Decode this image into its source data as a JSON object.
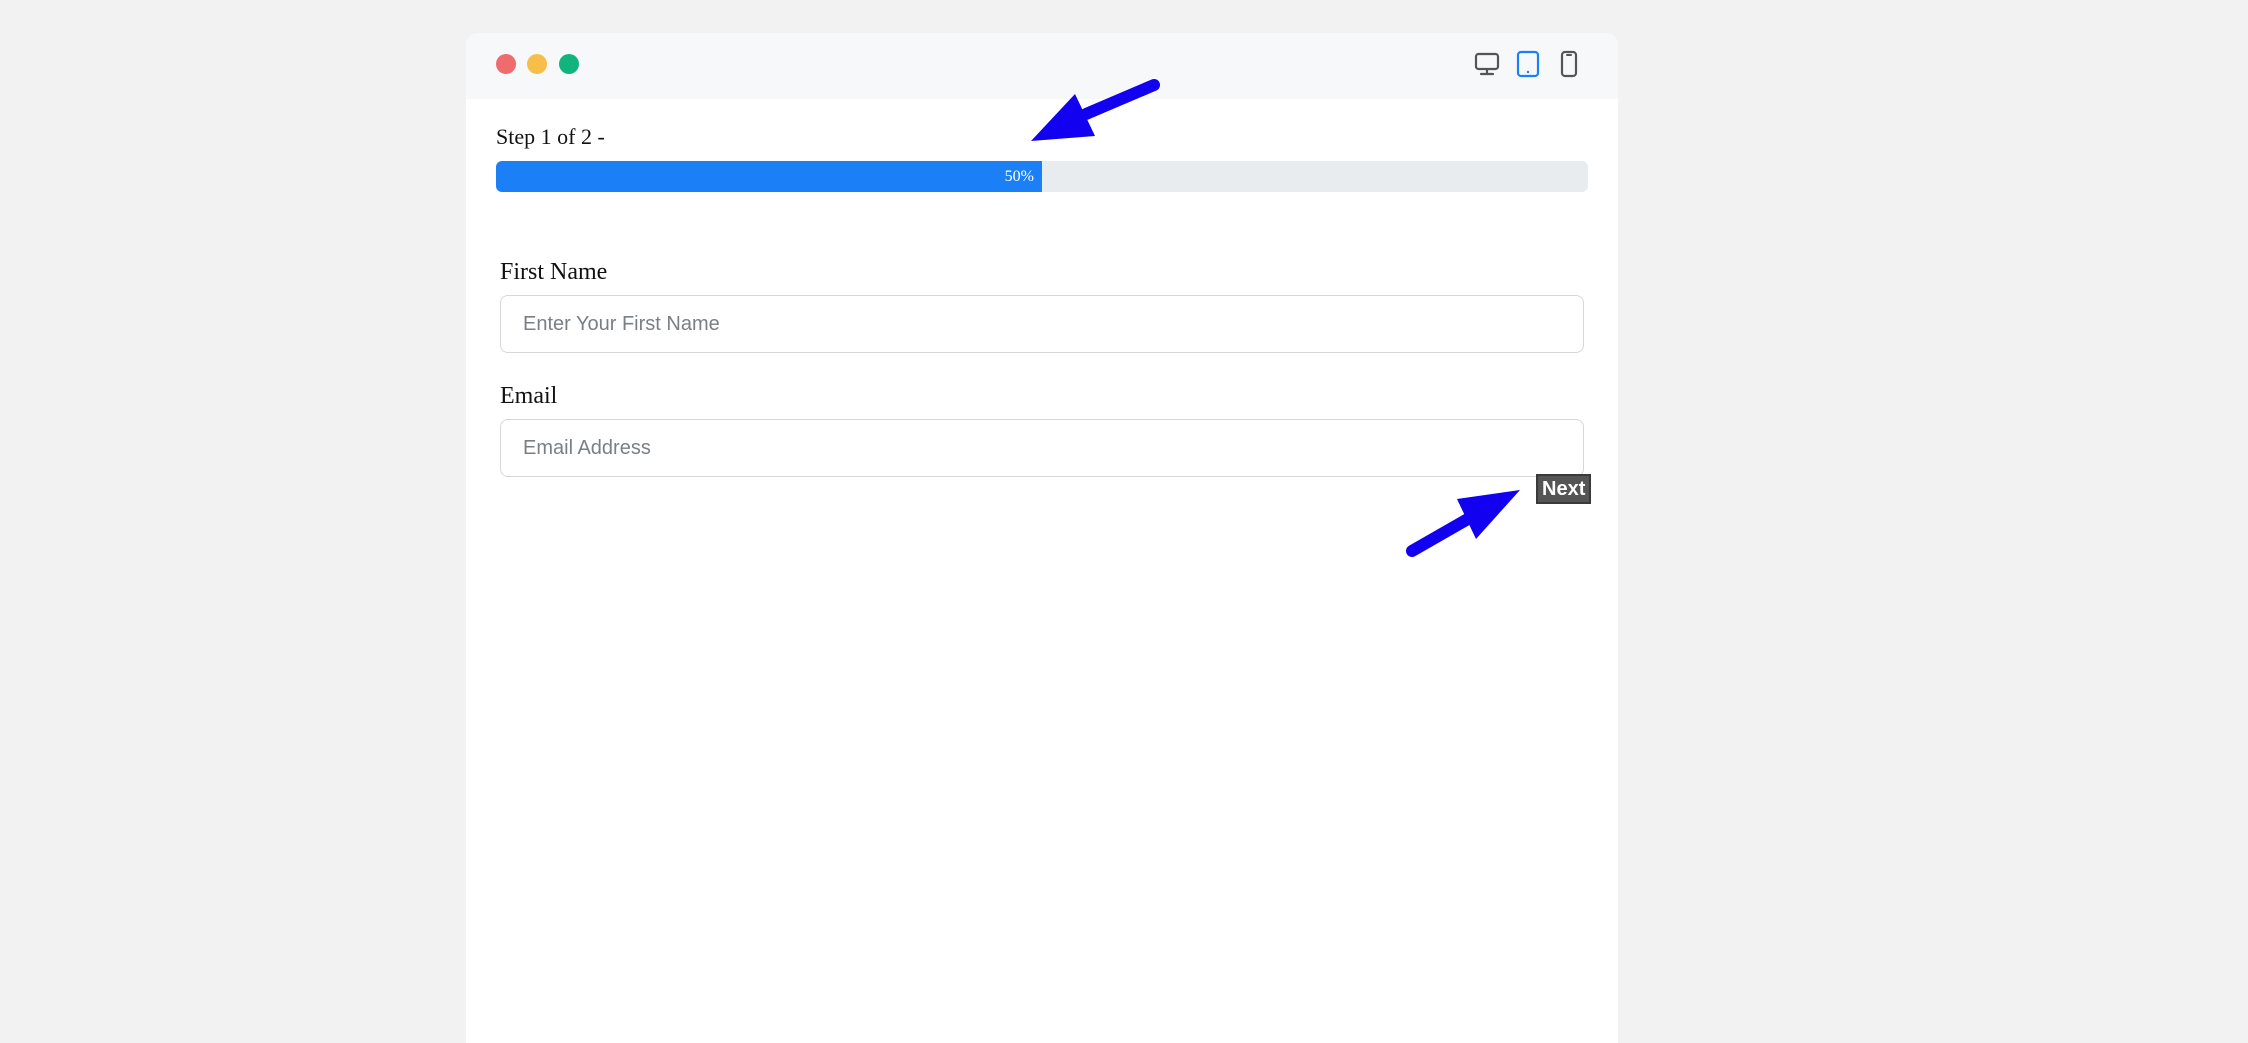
{
  "window": {
    "traffic_lights": {
      "close_color": "#ef6b6e",
      "minimize_color": "#f8be4a",
      "maximize_color": "#10b47c"
    },
    "device_toggle": {
      "icons": [
        "desktop-icon",
        "tablet-icon",
        "mobile-icon"
      ],
      "selected": "tablet-icon",
      "accent_color": "#1b80f5"
    }
  },
  "form": {
    "step_text": "Step 1 of 2 -",
    "progress": {
      "value_percent": 50,
      "label": "50%",
      "fill_color": "#1b80f5"
    },
    "fields": [
      {
        "label": "First Name",
        "placeholder": "Enter Your First Name",
        "value": ""
      },
      {
        "label": "Email",
        "placeholder": "Email Address",
        "value": ""
      }
    ],
    "next_label": "Next"
  },
  "annotations": {
    "arrow_color": "#1200f0"
  }
}
